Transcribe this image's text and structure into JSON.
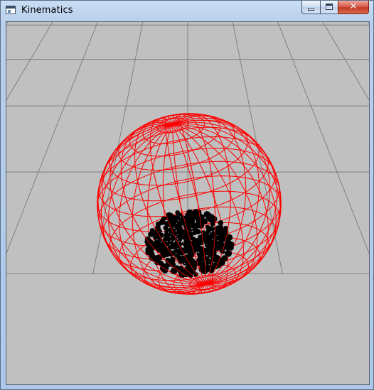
{
  "window": {
    "title": "Kinematics",
    "icon": "application-window-icon",
    "controls": {
      "minimize_icon": "minimize-icon",
      "maximize_icon": "maximize-icon",
      "close_glyph": "✕"
    }
  },
  "scene": {
    "background_color": "#c0c0c0",
    "grid_color": "#7a7a7a",
    "sphere_wireframe_color": "#ff0000",
    "particle_color": "#000000"
  }
}
